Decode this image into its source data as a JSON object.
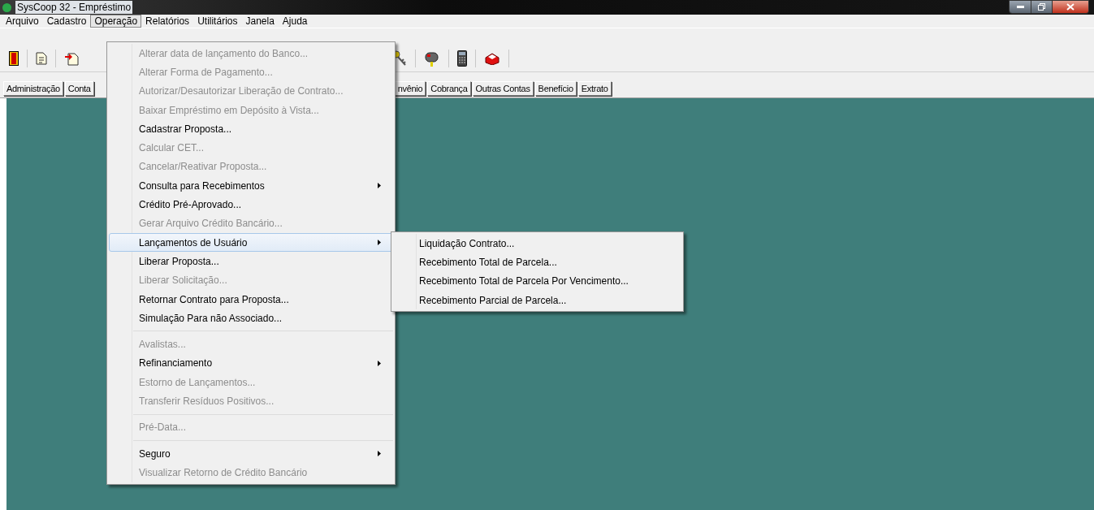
{
  "window": {
    "title": "SysCoop 32 - Empréstimo"
  },
  "menubar": [
    {
      "label": "Arquivo",
      "selected": false
    },
    {
      "label": "Cadastro",
      "selected": false
    },
    {
      "label": "Operação",
      "selected": true
    },
    {
      "label": "Relatórios",
      "selected": false
    },
    {
      "label": "Utilitários",
      "selected": false
    },
    {
      "label": "Janela",
      "selected": false
    },
    {
      "label": "Ajuda",
      "selected": false
    }
  ],
  "tabs_left": [
    "Administração",
    "Conta"
  ],
  "tabs_right": [
    "nvênio",
    "Cobrança",
    "Outras Contas",
    "Benefício",
    "Extrato"
  ],
  "menu": [
    {
      "kind": "item",
      "label": "Alterar data de lançamento do Banco...",
      "disabled": true,
      "submenu": false,
      "selected": false
    },
    {
      "kind": "item",
      "label": "Alterar Forma de Pagamento...",
      "disabled": true,
      "submenu": false,
      "selected": false
    },
    {
      "kind": "item",
      "label": "Autorizar/Desautorizar Liberação de Contrato...",
      "disabled": true,
      "submenu": false,
      "selected": false
    },
    {
      "kind": "item",
      "label": "Baixar Empréstimo em Depósito à Vista...",
      "disabled": true,
      "submenu": false,
      "selected": false
    },
    {
      "kind": "item",
      "label": "Cadastrar Proposta...",
      "disabled": false,
      "submenu": false,
      "selected": false
    },
    {
      "kind": "item",
      "label": "Calcular CET...",
      "disabled": true,
      "submenu": false,
      "selected": false
    },
    {
      "kind": "item",
      "label": "Cancelar/Reativar Proposta...",
      "disabled": true,
      "submenu": false,
      "selected": false
    },
    {
      "kind": "item",
      "label": "Consulta para Recebimentos",
      "disabled": false,
      "submenu": true,
      "selected": false
    },
    {
      "kind": "item",
      "label": "Crédito Pré-Aprovado...",
      "disabled": false,
      "submenu": false,
      "selected": false
    },
    {
      "kind": "item",
      "label": "Gerar Arquivo Crédito Bancário...",
      "disabled": true,
      "submenu": false,
      "selected": false
    },
    {
      "kind": "item",
      "label": "Lançamentos de Usuário",
      "disabled": false,
      "submenu": true,
      "selected": true
    },
    {
      "kind": "item",
      "label": "Liberar Proposta...",
      "disabled": false,
      "submenu": false,
      "selected": false
    },
    {
      "kind": "item",
      "label": "Liberar Solicitação...",
      "disabled": true,
      "submenu": false,
      "selected": false
    },
    {
      "kind": "item",
      "label": "Retornar Contrato para Proposta...",
      "disabled": false,
      "submenu": false,
      "selected": false
    },
    {
      "kind": "item",
      "label": "Simulação Para não Associado...",
      "disabled": false,
      "submenu": false,
      "selected": false
    },
    {
      "kind": "separator"
    },
    {
      "kind": "item",
      "label": "Avalistas...",
      "disabled": true,
      "submenu": false,
      "selected": false
    },
    {
      "kind": "item",
      "label": "Refinanciamento",
      "disabled": false,
      "submenu": true,
      "selected": false
    },
    {
      "kind": "item",
      "label": "Estorno de Lançamentos...",
      "disabled": true,
      "submenu": false,
      "selected": false
    },
    {
      "kind": "item",
      "label": "Transferir Resíduos Positivos...",
      "disabled": true,
      "submenu": false,
      "selected": false
    },
    {
      "kind": "separator"
    },
    {
      "kind": "item",
      "label": "Pré-Data...",
      "disabled": true,
      "submenu": false,
      "selected": false
    },
    {
      "kind": "separator"
    },
    {
      "kind": "item",
      "label": "Seguro",
      "disabled": false,
      "submenu": true,
      "selected": false
    },
    {
      "kind": "item",
      "label": "Visualizar Retorno de Crédito Bancário",
      "disabled": true,
      "submenu": false,
      "selected": false
    }
  ],
  "submenu": [
    {
      "label": "Liquidação Contrato..."
    },
    {
      "label": "Recebimento Total de Parcela..."
    },
    {
      "label": "Recebimento Total de Parcela Por Vencimento..."
    },
    {
      "label": "Recebimento Parcial de Parcela..."
    }
  ]
}
